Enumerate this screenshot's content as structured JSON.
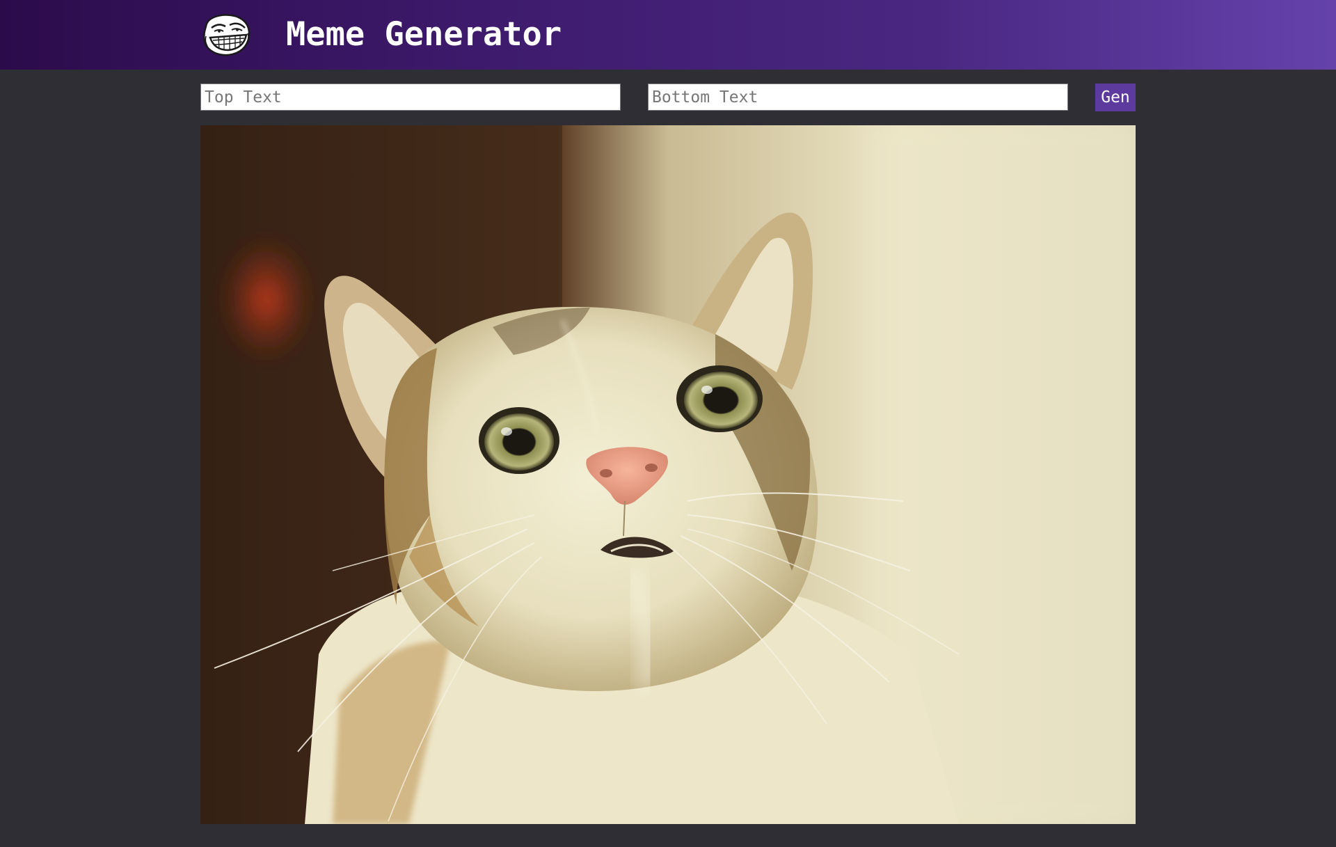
{
  "app": {
    "title": "Meme Generator",
    "logo_icon": "troll-face-icon",
    "accent_color": "#5d3a9e",
    "header_gradient": [
      "#2c0b4b",
      "#6442ab"
    ],
    "background_color": "#2f2e35"
  },
  "form": {
    "top_text": {
      "value": "",
      "placeholder": "Top Text"
    },
    "bottom_text": {
      "value": "",
      "placeholder": "Bottom Text"
    },
    "generate_label": "Gen"
  },
  "meme": {
    "image_subject": "surprised-cat-photo"
  }
}
